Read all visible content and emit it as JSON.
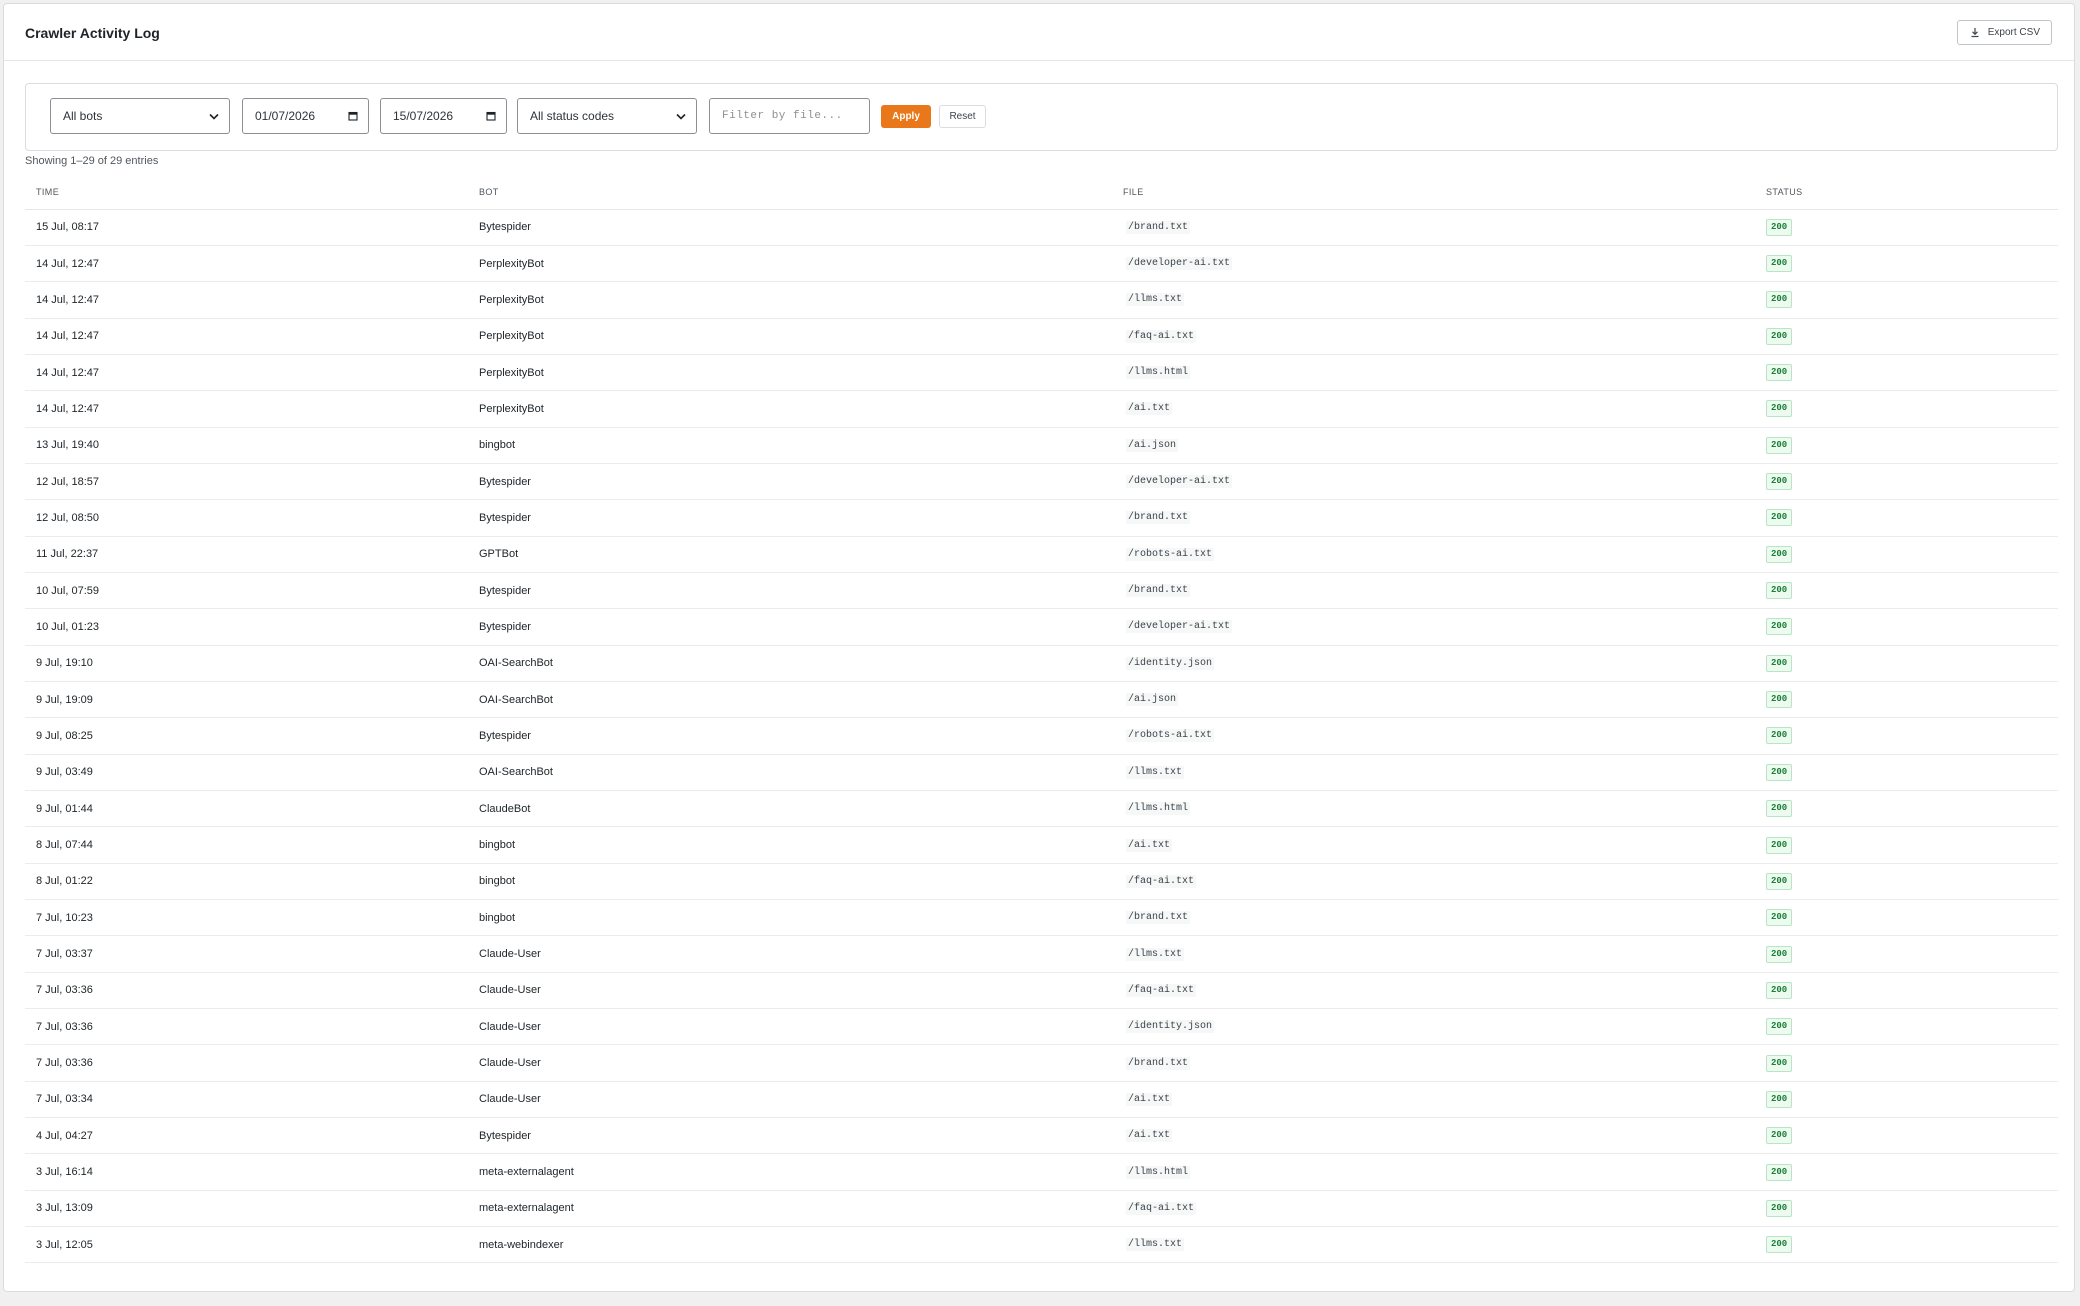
{
  "header": {
    "title": "Crawler Activity Log",
    "export_label": "Export CSV",
    "export_icon": "download-icon"
  },
  "filters": {
    "bot_select": "All bots",
    "date_from": "01/07/2026",
    "date_to": "15/07/2026",
    "status_select": "All status codes",
    "file_placeholder": "Filter by file...",
    "apply_label": "Apply",
    "reset_label": "Reset",
    "accent_color": "#e8781a"
  },
  "summary": "Showing 1–29 of 29 entries",
  "table": {
    "columns": [
      "TIME",
      "BOT",
      "FILE",
      "STATUS"
    ],
    "rows": [
      {
        "time": "15 Jul, 08:17",
        "bot": "Bytespider",
        "file": "/brand.txt",
        "status": "200"
      },
      {
        "time": "14 Jul, 12:47",
        "bot": "PerplexityBot",
        "file": "/developer-ai.txt",
        "status": "200"
      },
      {
        "time": "14 Jul, 12:47",
        "bot": "PerplexityBot",
        "file": "/llms.txt",
        "status": "200"
      },
      {
        "time": "14 Jul, 12:47",
        "bot": "PerplexityBot",
        "file": "/faq-ai.txt",
        "status": "200"
      },
      {
        "time": "14 Jul, 12:47",
        "bot": "PerplexityBot",
        "file": "/llms.html",
        "status": "200"
      },
      {
        "time": "14 Jul, 12:47",
        "bot": "PerplexityBot",
        "file": "/ai.txt",
        "status": "200"
      },
      {
        "time": "13 Jul, 19:40",
        "bot": "bingbot",
        "file": "/ai.json",
        "status": "200"
      },
      {
        "time": "12 Jul, 18:57",
        "bot": "Bytespider",
        "file": "/developer-ai.txt",
        "status": "200"
      },
      {
        "time": "12 Jul, 08:50",
        "bot": "Bytespider",
        "file": "/brand.txt",
        "status": "200"
      },
      {
        "time": "11 Jul, 22:37",
        "bot": "GPTBot",
        "file": "/robots-ai.txt",
        "status": "200"
      },
      {
        "time": "10 Jul, 07:59",
        "bot": "Bytespider",
        "file": "/brand.txt",
        "status": "200"
      },
      {
        "time": "10 Jul, 01:23",
        "bot": "Bytespider",
        "file": "/developer-ai.txt",
        "status": "200"
      },
      {
        "time": "9 Jul, 19:10",
        "bot": "OAI-SearchBot",
        "file": "/identity.json",
        "status": "200"
      },
      {
        "time": "9 Jul, 19:09",
        "bot": "OAI-SearchBot",
        "file": "/ai.json",
        "status": "200"
      },
      {
        "time": "9 Jul, 08:25",
        "bot": "Bytespider",
        "file": "/robots-ai.txt",
        "status": "200"
      },
      {
        "time": "9 Jul, 03:49",
        "bot": "OAI-SearchBot",
        "file": "/llms.txt",
        "status": "200"
      },
      {
        "time": "9 Jul, 01:44",
        "bot": "ClaudeBot",
        "file": "/llms.html",
        "status": "200"
      },
      {
        "time": "8 Jul, 07:44",
        "bot": "bingbot",
        "file": "/ai.txt",
        "status": "200"
      },
      {
        "time": "8 Jul, 01:22",
        "bot": "bingbot",
        "file": "/faq-ai.txt",
        "status": "200"
      },
      {
        "time": "7 Jul, 10:23",
        "bot": "bingbot",
        "file": "/brand.txt",
        "status": "200"
      },
      {
        "time": "7 Jul, 03:37",
        "bot": "Claude-User",
        "file": "/llms.txt",
        "status": "200"
      },
      {
        "time": "7 Jul, 03:36",
        "bot": "Claude-User",
        "file": "/faq-ai.txt",
        "status": "200"
      },
      {
        "time": "7 Jul, 03:36",
        "bot": "Claude-User",
        "file": "/identity.json",
        "status": "200"
      },
      {
        "time": "7 Jul, 03:36",
        "bot": "Claude-User",
        "file": "/brand.txt",
        "status": "200"
      },
      {
        "time": "7 Jul, 03:34",
        "bot": "Claude-User",
        "file": "/ai.txt",
        "status": "200"
      },
      {
        "time": "4 Jul, 04:27",
        "bot": "Bytespider",
        "file": "/ai.txt",
        "status": "200"
      },
      {
        "time": "3 Jul, 16:14",
        "bot": "meta-externalagent",
        "file": "/llms.html",
        "status": "200"
      },
      {
        "time": "3 Jul, 13:09",
        "bot": "meta-externalagent",
        "file": "/faq-ai.txt",
        "status": "200"
      },
      {
        "time": "3 Jul, 12:05",
        "bot": "meta-webindexer",
        "file": "/llms.txt",
        "status": "200"
      }
    ]
  }
}
